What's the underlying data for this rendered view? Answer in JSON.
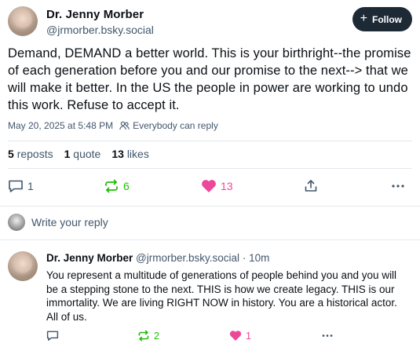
{
  "post": {
    "author_name": "Dr. Jenny Morber",
    "author_handle": "@jrmorber.bsky.social",
    "follow_label": "Follow",
    "text": "Demand, DEMAND a better world. This is your birthright--the promise of each generation before you and our promise to the next--> that we will make it better. In the US the people in power are working to undo this work. Refuse to accept it.",
    "timestamp": "May 20, 2025 at 5:48 PM",
    "audience": "Everybody can reply",
    "counts": {
      "reposts_num": "5",
      "reposts_label": "reposts",
      "quotes_num": "1",
      "quotes_label": "quote",
      "likes_num": "13",
      "likes_label": "likes"
    },
    "actions": {
      "reply_count": "1",
      "repost_count": "6",
      "like_count": "13"
    }
  },
  "reply_box": {
    "placeholder": "Write your reply"
  },
  "reply": {
    "author_name": "Dr. Jenny Morber",
    "author_handle": "@jrmorber.bsky.social",
    "separator": "·",
    "time": "10m",
    "text": "You represent a multitude of generations of people behind you and you will be a stepping stone to the next. THIS is how we create legacy. THIS is our immortality. We are living RIGHT NOW in history. You are a historical actor. All of us.",
    "actions": {
      "repost_count": "2",
      "like_count": "1"
    }
  },
  "colors": {
    "text": "#0b0f14",
    "muted": "#42576c",
    "follow_bg": "#1e2936",
    "repost_green": "#20bc07",
    "like_pink": "#ec4899",
    "divider": "#e3e8ed"
  },
  "icons": [
    "reply-icon",
    "repost-icon",
    "heart-icon",
    "share-icon",
    "more-icon",
    "people-icon",
    "plus-icon"
  ]
}
